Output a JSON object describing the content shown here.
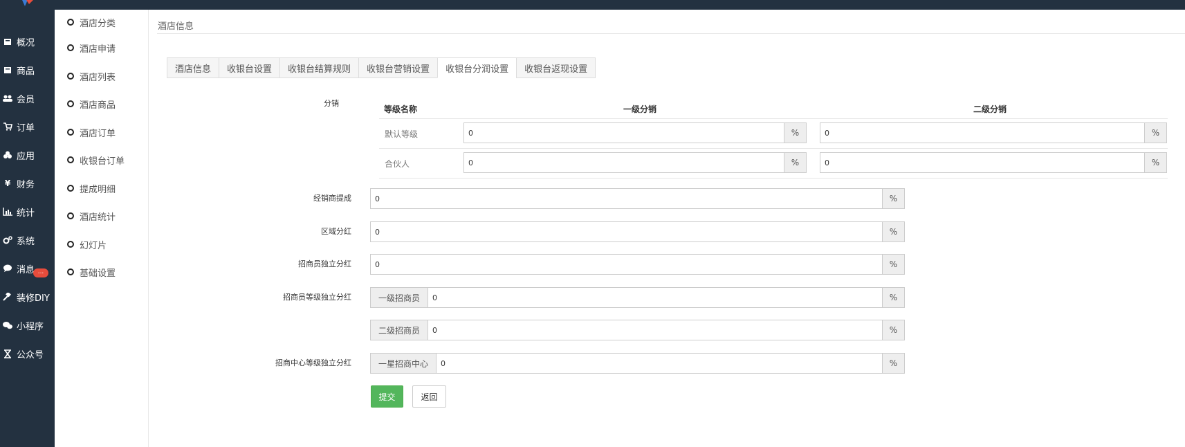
{
  "sidebar": {
    "items": [
      {
        "label": "概况",
        "icon": "dashboard-icon"
      },
      {
        "label": "商品",
        "icon": "product-icon"
      },
      {
        "label": "会员",
        "icon": "users-icon"
      },
      {
        "label": "订单",
        "icon": "cart-icon"
      },
      {
        "label": "应用",
        "icon": "apps-icon"
      },
      {
        "label": "财务",
        "icon": "yen-icon"
      },
      {
        "label": "统计",
        "icon": "chart-icon"
      },
      {
        "label": "系统",
        "icon": "gears-icon"
      },
      {
        "label": "消息",
        "icon": "chat-icon",
        "badge": "..."
      },
      {
        "label": "装修DIY",
        "icon": "gavel-icon"
      },
      {
        "label": "小程序",
        "icon": "wechat-icon"
      },
      {
        "label": "公众号",
        "icon": "hourglass-icon"
      }
    ]
  },
  "subnav": {
    "items": [
      "酒店分类",
      "酒店申请",
      "酒店列表",
      "酒店商品",
      "酒店订单",
      "收银台订单",
      "提成明细",
      "酒店统计",
      "幻灯片",
      "基础设置"
    ]
  },
  "breadcrumb": "酒店信息",
  "tabs": [
    {
      "label": "酒店信息",
      "active": false
    },
    {
      "label": "收银台设置",
      "active": false
    },
    {
      "label": "收银台结算规则",
      "active": false
    },
    {
      "label": "收银台营销设置",
      "active": false
    },
    {
      "label": "收银台分润设置",
      "active": true
    },
    {
      "label": "收银台返现设置",
      "active": false
    }
  ],
  "distribution": {
    "label": "分销",
    "headers": {
      "level": "等级名称",
      "first": "一级分销",
      "second": "二级分销"
    },
    "rows": [
      {
        "name": "默认等级",
        "first": "0",
        "second": "0"
      },
      {
        "name": "合伙人",
        "first": "0",
        "second": "0"
      }
    ],
    "unit": "%"
  },
  "fields": {
    "dealer": {
      "label": "经销商提成",
      "value": "0",
      "unit": "%"
    },
    "region": {
      "label": "区域分红",
      "value": "0",
      "unit": "%"
    },
    "merchant": {
      "label": "招商员独立分红",
      "value": "0",
      "unit": "%"
    },
    "merchant_level": {
      "label": "招商员等级独立分红",
      "rows": [
        {
          "prefix": "一级招商员",
          "value": "0"
        },
        {
          "prefix": "二级招商员",
          "value": "0"
        }
      ],
      "unit": "%"
    },
    "center_level": {
      "label": "招商中心等级独立分红",
      "rows": [
        {
          "prefix": "一星招商中心",
          "value": "0"
        }
      ],
      "unit": "%"
    }
  },
  "buttons": {
    "submit": "提交",
    "back": "返回"
  },
  "colors": {
    "sidebar": "#233140",
    "submit": "#53b65c",
    "badge": "#e74c3c"
  }
}
